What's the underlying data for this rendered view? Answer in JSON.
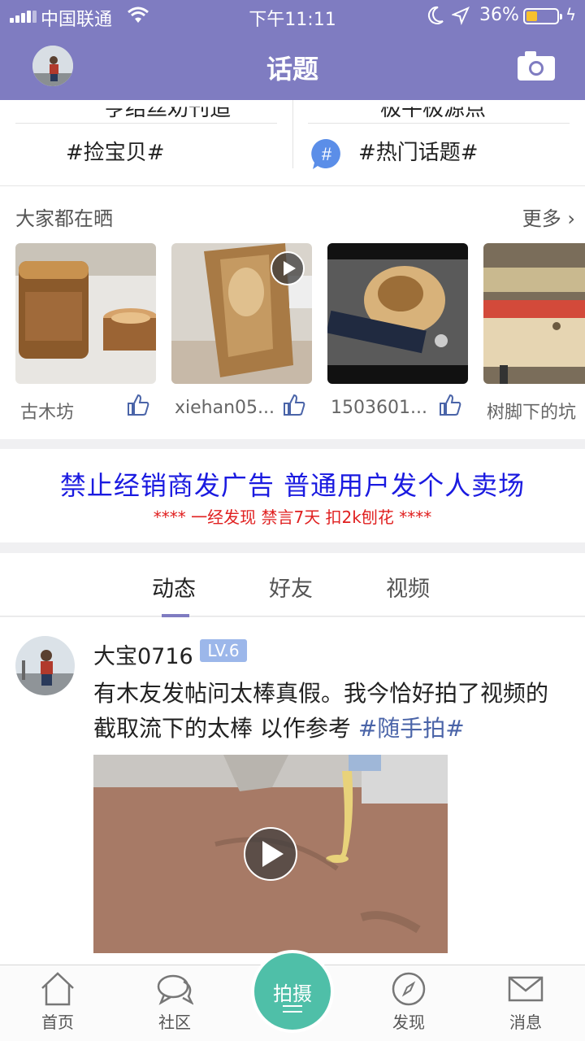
{
  "status_bar": {
    "carrier": "中国联通",
    "time": "下午11:11",
    "battery_percent": "36%",
    "battery_level": 0.36
  },
  "header": {
    "title": "话题"
  },
  "topics": {
    "partial_left": "亨结丝劝刊追",
    "partial_right": "极平极源点",
    "items": [
      "#捡宝贝#",
      "#热门话题#"
    ]
  },
  "sunbathing": {
    "title": "大家都在晒",
    "more_label": "更多 ›",
    "items": [
      {
        "name": "古木坊",
        "video": false
      },
      {
        "name": "xiehan05...",
        "video": true
      },
      {
        "name": "1503601...",
        "video": false
      },
      {
        "name": "树脚下的坑",
        "video": false
      }
    ]
  },
  "notice": {
    "line1": "禁止经销商发广告  普通用户发个人卖场",
    "line2": "****   一经发现  禁言7天  扣2k刨花   ****"
  },
  "feed_tabs": [
    "动态",
    "好友",
    "视频"
  ],
  "post": {
    "author": "大宝0716",
    "level": "LV.6",
    "text": "有木友发帖问太棒真假。我今恰好拍了视频的 截取流下的太棒 以作参考 ",
    "tag": "#随手拍#"
  },
  "tabbar": {
    "home": "首页",
    "community": "社区",
    "shoot": "拍摄",
    "discover": "发现",
    "messages": "消息"
  },
  "colors": {
    "brand": "#7f7cc1",
    "accent_green": "#4fbfa8",
    "notice_blue": "#1a1ae0",
    "notice_red": "#e02020",
    "tag_blue": "#4a64a8"
  }
}
